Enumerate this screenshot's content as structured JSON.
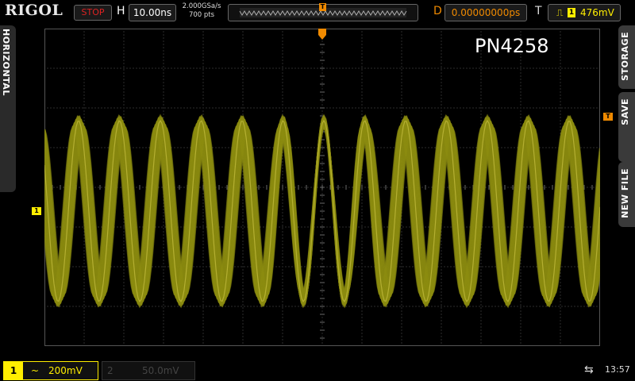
{
  "header": {
    "brand": "RIGOL",
    "run_status": "STOP",
    "h_label": "H",
    "timebase": "10.00ns",
    "sample_rate": "2.000GSa/s",
    "mem_depth": "700 pts",
    "d_label": "D",
    "delay": "0.00000000ps",
    "t_label": "T",
    "trigger_channel": "1",
    "trigger_level": "476mV",
    "trigger_edge_icon": "rising-edge-icon",
    "marker_label": "T"
  },
  "left_tab": {
    "label": "HORIZONTAL"
  },
  "right_tabs": [
    {
      "label": "STORAGE"
    },
    {
      "label": "SAVE"
    },
    {
      "label": "NEW FILE"
    }
  ],
  "screen": {
    "overlay_text": "PN4258",
    "ch1_marker": "1",
    "trigger_marker": "T",
    "top_trigger_marker": "T"
  },
  "footer": {
    "ch1_number": "1",
    "ch1_coupling": "~",
    "ch1_scale": "200mV",
    "ch2_number": "2",
    "ch2_scale": "50.0mV",
    "usb_icon": "usb-icon",
    "time": "13:57"
  },
  "colors": {
    "ch1": "#ffee00",
    "trace": "#8c8c10",
    "trigger": "#f08a00",
    "stop": "#dd2222",
    "grid": "#555555"
  }
}
